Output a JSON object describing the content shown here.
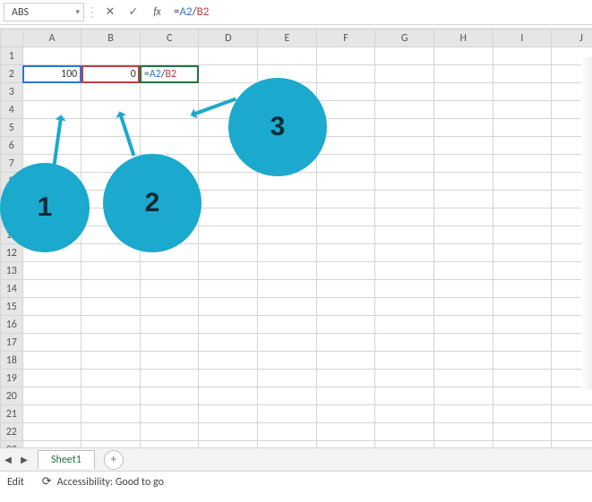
{
  "name_box": {
    "value": "ABS",
    "caret": "▾"
  },
  "formula_bar": {
    "cancel_glyph": "✕",
    "enter_glyph": "✓",
    "fx_glyph": "fx",
    "eq": "=",
    "ref_a": "A2",
    "slash": "/",
    "ref_b": "B2"
  },
  "columns": [
    "A",
    "B",
    "C",
    "D",
    "E",
    "F",
    "G",
    "H",
    "I",
    "J"
  ],
  "row_count": 23,
  "cells": {
    "A2": "100",
    "B2": "0",
    "C2_eq": "=",
    "C2_a": "A2",
    "C2_s": "/",
    "C2_b": "B2"
  },
  "annotations": {
    "b1": "1",
    "b2": "2",
    "b3": "3"
  },
  "tabs": {
    "prev_glyph": "◀",
    "next_glyph": "▶",
    "sheet_label": "Sheet1",
    "add_glyph": "+"
  },
  "status": {
    "mode": "Edit",
    "acc_icon": "⟳",
    "acc_text": "Accessibility: Good to go"
  },
  "chart_data": {
    "type": "table",
    "note": "Spreadsheet cell contents and the formula being entered",
    "cells": [
      {
        "cell": "A2",
        "value": 100
      },
      {
        "cell": "B2",
        "value": 0
      },
      {
        "cell": "C2",
        "formula": "=A2/B2"
      }
    ],
    "name_box": "ABS",
    "formula_bar": "=A2/B2",
    "annotation_callouts": {
      "1": "A2",
      "2": "B2",
      "3": "C2"
    }
  }
}
